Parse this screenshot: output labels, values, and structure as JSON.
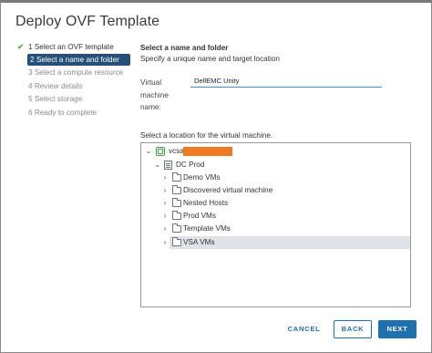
{
  "dialog": {
    "title": "Deploy OVF Template"
  },
  "steps": [
    {
      "label": "1 Select an OVF template",
      "state": "done"
    },
    {
      "label": "2 Select a name and folder",
      "state": "active"
    },
    {
      "label": "3 Select a compute resource",
      "state": "pending"
    },
    {
      "label": "4 Review details",
      "state": "pending"
    },
    {
      "label": "5 Select storage",
      "state": "pending"
    },
    {
      "label": "6 Ready to complete",
      "state": "pending"
    }
  ],
  "panel": {
    "title": "Select a name and folder",
    "subtitle": "Specify a unique name and target location",
    "name_label": "Virtual machine name:",
    "name_value": "DellEMC Unity",
    "location_label": "Select a location for the virtual machine."
  },
  "tree": {
    "root": {
      "label": "vcsa.",
      "expanded": true,
      "icon": "vcenter-icon"
    },
    "datacenter": {
      "label": "DC Prod",
      "expanded": true,
      "icon": "datacenter-icon"
    },
    "folders": [
      {
        "label": "Demo VMs",
        "selected": false
      },
      {
        "label": "Discovered virtual machine",
        "selected": false
      },
      {
        "label": "Nested Hosts",
        "selected": false
      },
      {
        "label": "Prod VMs",
        "selected": false
      },
      {
        "label": "Template VMs",
        "selected": false
      },
      {
        "label": "VSA VMs",
        "selected": true
      }
    ]
  },
  "buttons": {
    "cancel": "CANCEL",
    "back": "BACK",
    "next": "NEXT"
  },
  "colors": {
    "accent": "#1f70b0",
    "active_step": "#26507a",
    "check": "#3b9c33",
    "redaction": "#f07a22",
    "selection": "#dfe3e8"
  }
}
